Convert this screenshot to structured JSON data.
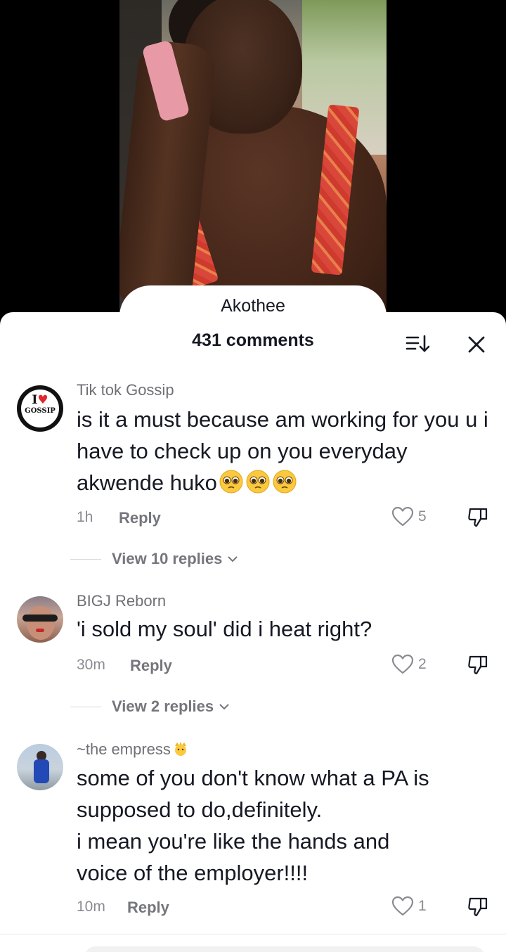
{
  "video": {
    "overlay_label": "Akothee"
  },
  "header": {
    "comment_count": "431 comments"
  },
  "comments": [
    {
      "username": "Tik tok Gossip",
      "avatar_text_top": "I",
      "avatar_text_bottom": "GOSSIP",
      "text": "is it a must because am working for you u i have to check up on you everyday akwende huko",
      "time": "1h",
      "reply_label": "Reply",
      "likes": "5",
      "view_replies": "View 10 replies"
    },
    {
      "username": "BIGJ Reborn",
      "text": "'i sold my soul' did i heat right?",
      "time": "30m",
      "reply_label": "Reply",
      "likes": "2",
      "view_replies": "View 2 replies"
    },
    {
      "username": "~the empress",
      "text_line1": "some of you don't know what a PA is",
      "text_line2": "supposed to do,definitely.",
      "text_line3": "i mean you're like the hands and",
      "text_line4": "voice of the employer!!!!",
      "time": "10m",
      "reply_label": "Reply",
      "likes": "1"
    }
  ],
  "colors": {
    "text": "#161823",
    "muted": "#8a8b91",
    "heart_stroke": "#8a8b91"
  }
}
